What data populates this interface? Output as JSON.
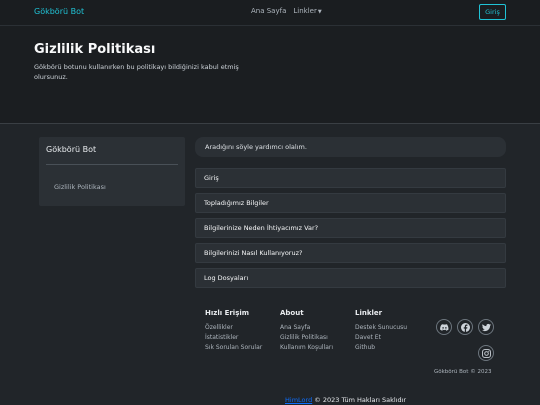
{
  "navbar": {
    "brand": "Gökbörü Bot",
    "links": [
      "Ana Sayfa",
      "Linkler"
    ],
    "login": "Giriş"
  },
  "hero": {
    "title": "Gizlilik Politikası",
    "subtitle": "Gökbörü botunu kullanırken bu politikayı bildiğinizi kabul etmiş olursunuz."
  },
  "sidebar": {
    "title": "Gökbörü Bot",
    "items": [
      "Gizlilik Politikası"
    ]
  },
  "alert": "Aradığını söyle yardımcı olalım.",
  "accordion": [
    "Giriş",
    "Topladığımız Bilgiler",
    "Bilgilerinize Neden İhtiyacımız Var?",
    "Bilgilerinizi Nasıl Kullanıyoruz?",
    "Log Dosyaları"
  ],
  "footer": {
    "columns": [
      {
        "title": "Hızlı Erişim",
        "links": [
          "Özellikler",
          "İstatistikler",
          "Sık Sorulan Sorular"
        ]
      },
      {
        "title": "About",
        "links": [
          "Ana Sayfa",
          "Gizlilik Politikası",
          "Kullanım Koşulları"
        ]
      },
      {
        "title": "Linkler",
        "links": [
          "Destek Sunucusu",
          "Davet Et",
          "Github"
        ]
      }
    ],
    "social_icons": [
      "discord-icon",
      "facebook-icon",
      "twitter-icon",
      "instagram-icon"
    ],
    "copy_small": "Gökbörü Bot © 2023",
    "copy_link": "HimLord",
    "copy_text": " © 2023 Tüm Hakları Saklıdır"
  },
  "colors": {
    "background": "#212529",
    "accent": "#20c3d6",
    "link": "#0d6efd"
  }
}
